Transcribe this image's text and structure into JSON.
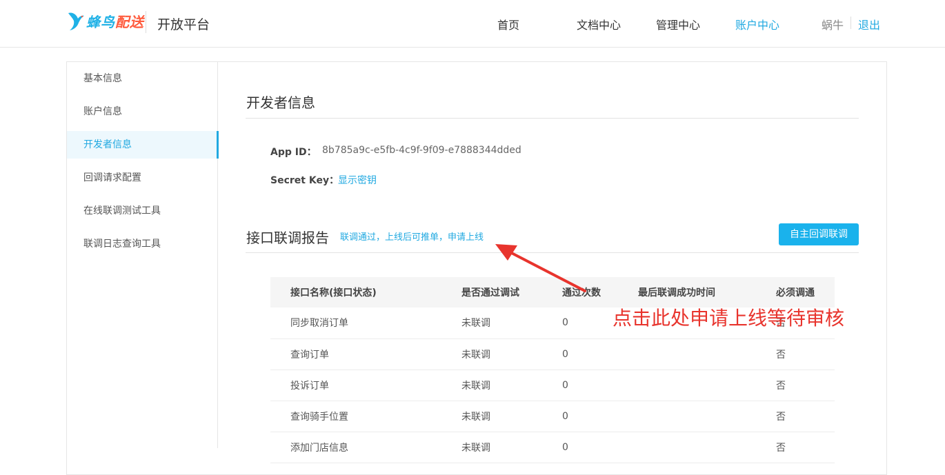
{
  "header": {
    "logo_text_part1": "蜂鸟",
    "logo_text_part2": "配送",
    "platform": "开放平台",
    "nav": [
      {
        "label": "首页",
        "active": false
      },
      {
        "label": "文档中心",
        "active": false
      },
      {
        "label": "管理中心",
        "active": false
      },
      {
        "label": "账户中心",
        "active": true
      }
    ],
    "user_name": "蜗牛",
    "logout": "退出"
  },
  "sidebar": {
    "items": [
      {
        "label": "基本信息",
        "active": false
      },
      {
        "label": "账户信息",
        "active": false
      },
      {
        "label": "开发者信息",
        "active": true
      },
      {
        "label": "回调请求配置",
        "active": false
      },
      {
        "label": "在线联调测试工具",
        "active": false
      },
      {
        "label": "联调日志查询工具",
        "active": false
      }
    ]
  },
  "developer": {
    "title": "开发者信息",
    "app_id_label": "App ID：",
    "app_id_value": "8b785a9c-e5fb-4c9f-9f09-e7888344dded",
    "secret_key_label": "Secret Key：",
    "secret_key_link": "显示密钥"
  },
  "report": {
    "title": "接口联调报告",
    "notice": "联调通过，上线后可推单，申请上线",
    "self_callback_button": "自主回调联调",
    "columns": [
      "接口名称(接口状态)",
      "是否通过调试",
      "通过次数",
      "最后联调成功时间",
      "必须调通"
    ],
    "rows": [
      [
        "同步取消订单",
        "未联调",
        "0",
        "",
        "否"
      ],
      [
        "查询订单",
        "未联调",
        "0",
        "",
        "否"
      ],
      [
        "投诉订单",
        "未联调",
        "0",
        "",
        "否"
      ],
      [
        "查询骑手位置",
        "未联调",
        "0",
        "",
        "否"
      ],
      [
        "添加门店信息",
        "未联调",
        "0",
        "",
        "否"
      ]
    ]
  },
  "annotation": {
    "text": "点击此处申请上线等待审核",
    "color": "#e8342d"
  },
  "colors": {
    "accent": "#21a9e1",
    "button": "#1ab2ec",
    "logo_orange": "#ff5a3c"
  }
}
